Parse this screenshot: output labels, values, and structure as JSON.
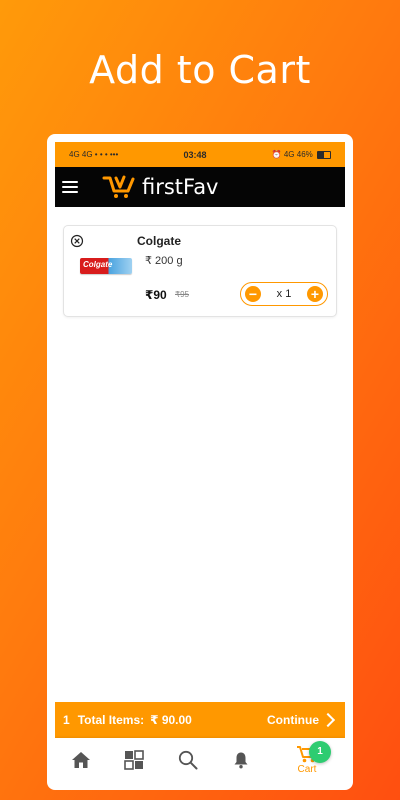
{
  "headline": "Add to Cart",
  "status_bar": {
    "left": "4G 4G • • • •••",
    "time": "03:48",
    "right": "⏰ 4G",
    "battery": "46%"
  },
  "app_bar": {
    "brand": "firstFav",
    "menu_icon": "hamburger-menu-icon",
    "logo_icon": "cart-logo-icon"
  },
  "cart_item": {
    "name": "Colgate",
    "image_text": "Colgate",
    "weight": "₹ 200 g",
    "price": "₹90",
    "mrp": "₹95",
    "quantity": "x 1",
    "minus": "−",
    "plus": "+"
  },
  "cart_bar": {
    "count": "1",
    "total_label": "Total Items:",
    "total_value": "₹ 90.00",
    "continue": "Continue"
  },
  "bottom_nav": {
    "items": [
      {
        "icon": "home-icon"
      },
      {
        "icon": "categories-icon"
      },
      {
        "icon": "search-icon"
      },
      {
        "icon": "bell-icon"
      },
      {
        "icon": "cart-icon",
        "label": "Cart",
        "badge": "1"
      }
    ]
  },
  "colors": {
    "accent": "#ff9800",
    "background_start": "#ff9a0a",
    "background_end": "#ff4f10",
    "badge": "#2ecc71",
    "app_bar": "#050505"
  }
}
